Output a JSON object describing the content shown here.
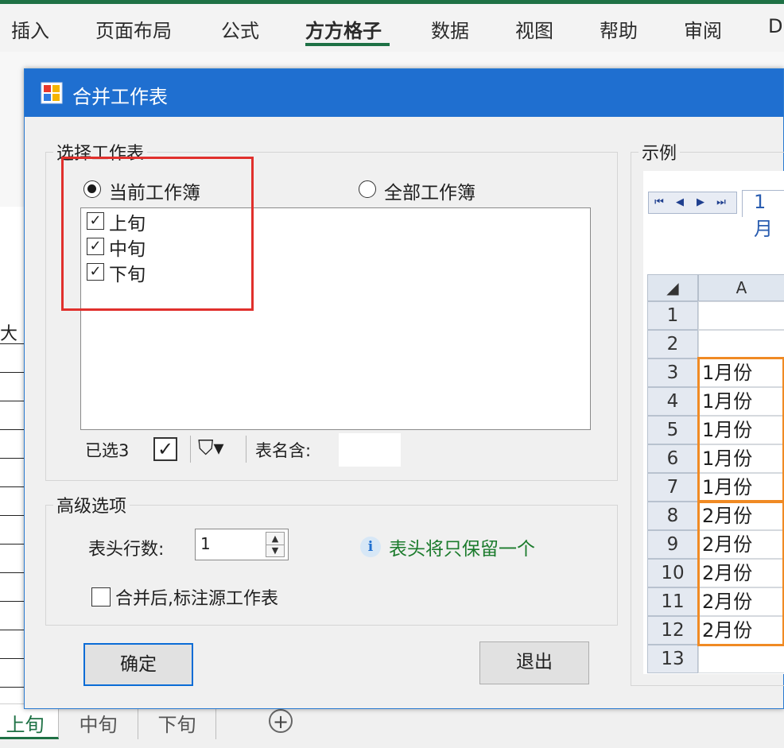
{
  "ribbon": {
    "tabs": [
      "插入",
      "页面布局",
      "公式",
      "方方格子",
      "数据",
      "视图",
      "帮助",
      "审阅",
      "D"
    ],
    "active_tab": "方方格子"
  },
  "sheet": {
    "cell_text": "大",
    "tabs": [
      "上旬",
      "中旬",
      "下旬"
    ],
    "active_tab": "上旬",
    "add_icon": "plus-circle-icon"
  },
  "dialog": {
    "title": "合并工作表",
    "select_group": {
      "label": "选择工作表",
      "radio_current": "当前工作簿",
      "radio_all": "全部工作簿",
      "selected_radio": "当前工作簿",
      "sheets": [
        {
          "name": "上旬",
          "checked": true
        },
        {
          "name": "中旬",
          "checked": true
        },
        {
          "name": "下旬",
          "checked": true
        }
      ],
      "selected_count": "已选3",
      "name_contains_label": "表名含:",
      "name_contains_value": ""
    },
    "advanced_group": {
      "label": "高级选项",
      "header_rows_label": "表头行数:",
      "header_rows_value": "1",
      "info_text": "表头将只保留一个",
      "mark_source_label": "合并后,标注源工作表",
      "mark_source_checked": false
    },
    "buttons": {
      "ok": "确定",
      "exit": "退出"
    },
    "example": {
      "label": "示例",
      "tab_label": "1月",
      "column_header": "A",
      "rows": [
        {
          "row": "1",
          "value": ""
        },
        {
          "row": "2",
          "value": ""
        },
        {
          "row": "3",
          "value": "1月份"
        },
        {
          "row": "4",
          "value": "1月份"
        },
        {
          "row": "5",
          "value": "1月份"
        },
        {
          "row": "6",
          "value": "1月份"
        },
        {
          "row": "7",
          "value": "1月份"
        },
        {
          "row": "8",
          "value": "2月份"
        },
        {
          "row": "9",
          "value": "2月份"
        },
        {
          "row": "10",
          "value": "2月份"
        },
        {
          "row": "11",
          "value": "2月份"
        },
        {
          "row": "12",
          "value": "2月份"
        },
        {
          "row": "13",
          "value": ""
        }
      ]
    }
  },
  "colors": {
    "title_bar": "#1f6fd0",
    "highlight_red": "#e0302c",
    "highlight_orange": "#f08a24",
    "info_green": "#1b7b2c",
    "excel_green": "#1e7145"
  }
}
